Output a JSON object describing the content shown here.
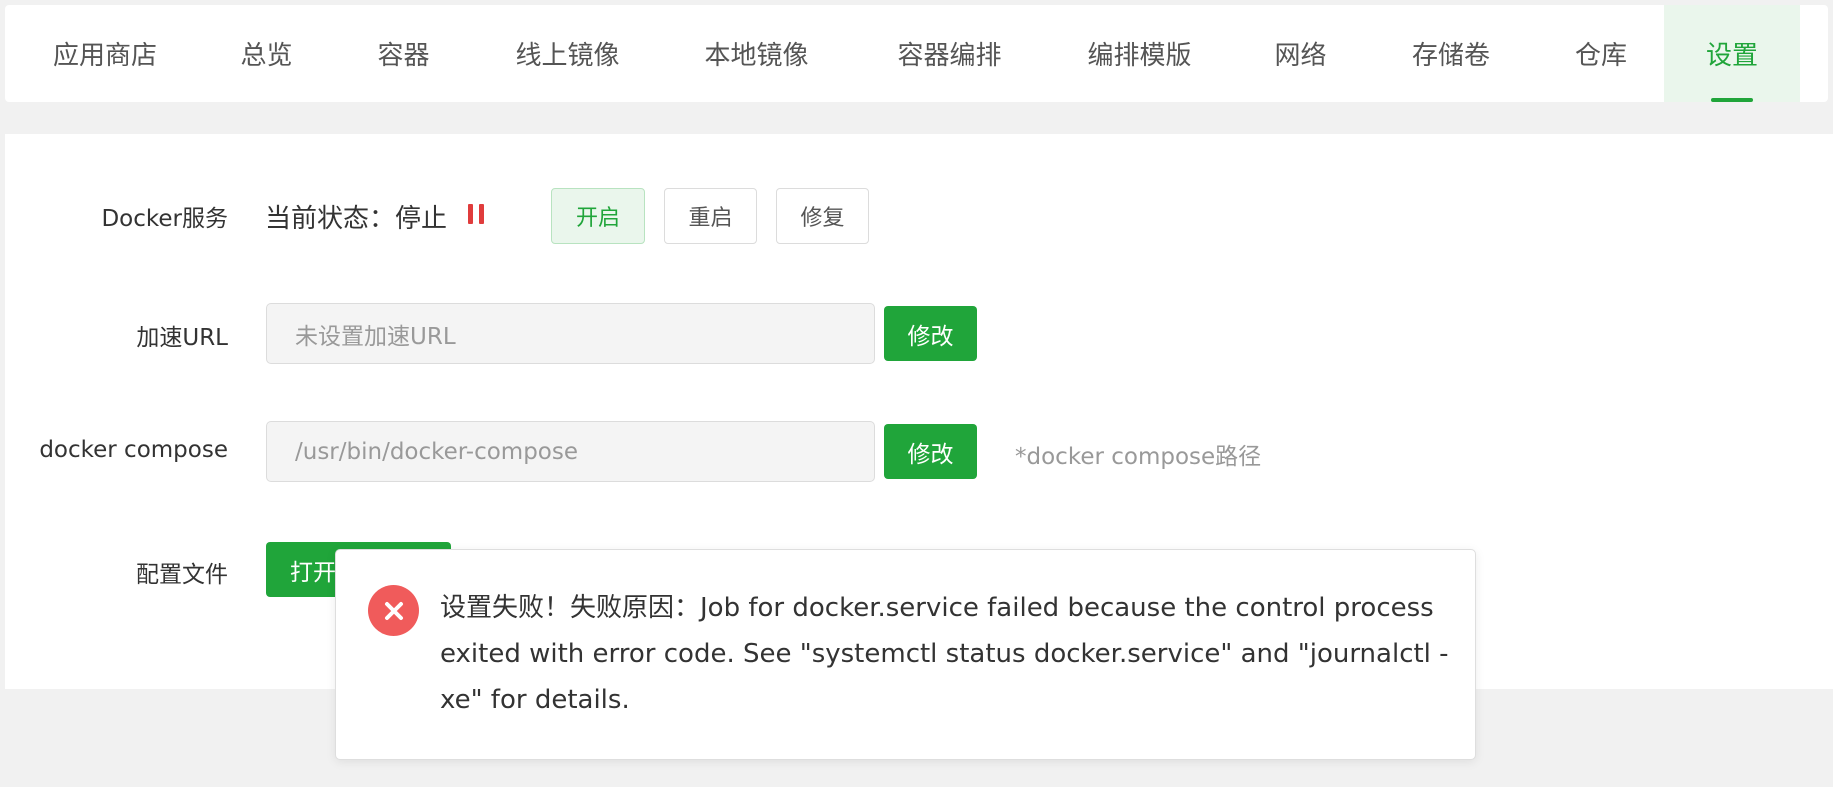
{
  "tabs": [
    {
      "label": "应用商店",
      "active": false
    },
    {
      "label": "总览",
      "active": false
    },
    {
      "label": "容器",
      "active": false
    },
    {
      "label": "线上镜像",
      "active": false
    },
    {
      "label": "本地镜像",
      "active": false
    },
    {
      "label": "容器编排",
      "active": false
    },
    {
      "label": "编排模版",
      "active": false
    },
    {
      "label": "网络",
      "active": false
    },
    {
      "label": "存储卷",
      "active": false
    },
    {
      "label": "仓库",
      "active": false
    },
    {
      "label": "设置",
      "active": true
    }
  ],
  "docker_service": {
    "label": "Docker服务",
    "status_text": "当前状态：停止",
    "status_icon": "pause-icon",
    "buttons": {
      "start": "开启",
      "restart": "重启",
      "repair": "修复"
    }
  },
  "mirror": {
    "label": "加速URL",
    "placeholder": "未设置加速URL",
    "button": "修改"
  },
  "compose": {
    "label": "docker compose",
    "placeholder": "/usr/bin/docker-compose",
    "button": "修改",
    "hint": "*docker compose路径"
  },
  "config": {
    "label": "配置文件",
    "button": "打开配置文件"
  },
  "toast": {
    "icon": "close-icon",
    "message": "设置失败！失败原因：Job for docker.service failed because the control process exited with error code. See \"systemctl status docker.service\" and \"journalctl -xe\" for details."
  },
  "colors": {
    "accent": "#20a53a",
    "error": "#f05b5b",
    "status_stopped": "#e03c3c"
  }
}
